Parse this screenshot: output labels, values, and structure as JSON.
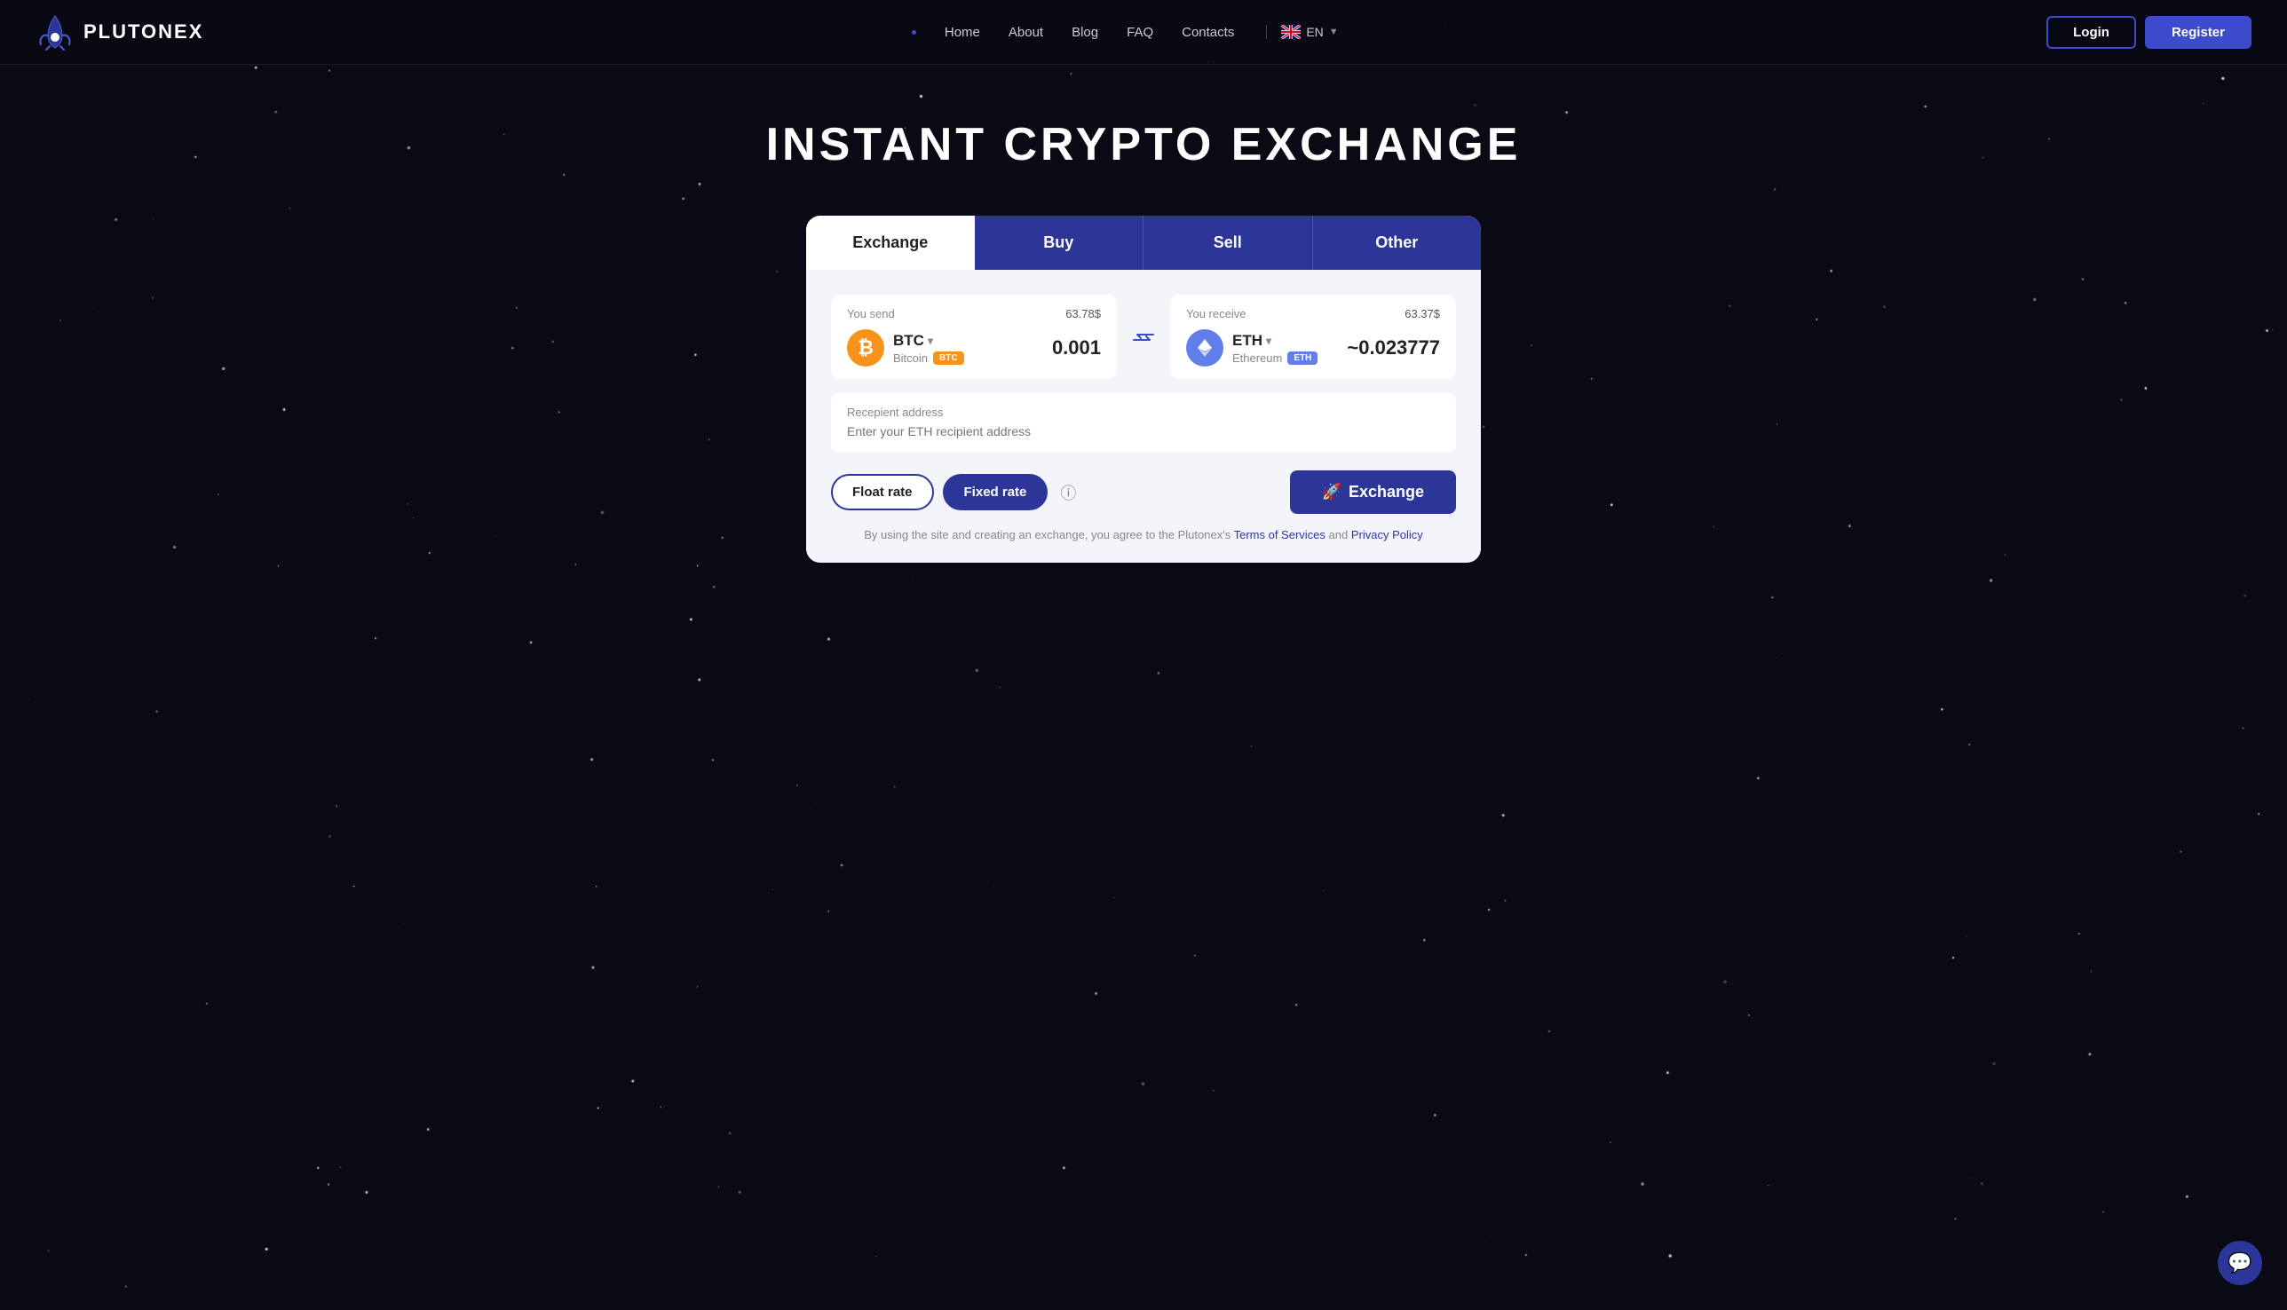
{
  "brand": {
    "name": "PLUTONEX"
  },
  "navbar": {
    "nav_items": [
      {
        "label": "Home"
      },
      {
        "label": "About"
      },
      {
        "label": "Blog"
      },
      {
        "label": "FAQ"
      },
      {
        "label": "Contacts"
      }
    ],
    "language": "EN",
    "login_label": "Login",
    "register_label": "Register"
  },
  "hero": {
    "title": "INSTANT CRYPTO EXCHANGE"
  },
  "exchange_card": {
    "tabs": [
      {
        "id": "exchange",
        "label": "Exchange",
        "active": true
      },
      {
        "id": "buy",
        "label": "Buy"
      },
      {
        "id": "sell",
        "label": "Sell"
      },
      {
        "id": "other",
        "label": "Other"
      }
    ],
    "send": {
      "label": "You send",
      "usd_value": "63.78$",
      "currency": "BTC",
      "currency_full": "Bitcoin",
      "badge": "BTC",
      "amount": "0.001"
    },
    "receive": {
      "label": "You receive",
      "usd_value": "63.37$",
      "currency": "ETH",
      "currency_full": "Ethereum",
      "badge": "ETH",
      "amount": "~0.023777"
    },
    "recipient": {
      "label": "Recepient address",
      "placeholder": "Enter your ETH recipient address"
    },
    "rate_buttons": {
      "float_label": "Float rate",
      "fixed_label": "Fixed rate"
    },
    "exchange_button": {
      "icon": "🚀",
      "label": "Exchange"
    },
    "footer_text": "By using the site and creating an exchange, you agree to the Plutonex's",
    "footer_terms": "Terms of Services",
    "footer_and": "and",
    "footer_privacy": "Privacy Policy"
  },
  "chat_icon": "💬"
}
